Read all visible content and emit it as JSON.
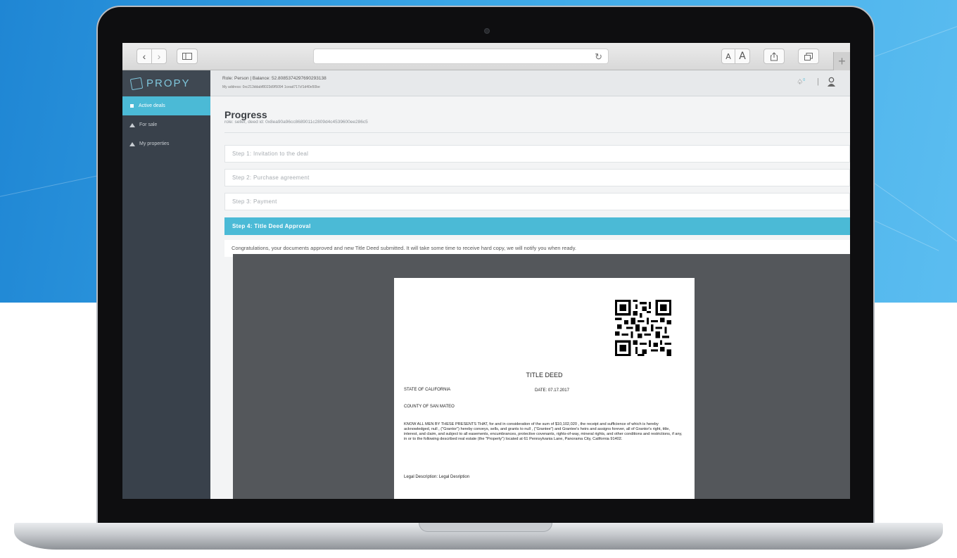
{
  "toolbar": {
    "back_icon": "chevron-left",
    "forward_icon": "chevron-right",
    "sidebar_icon": "sidebar",
    "reload_icon": "reload",
    "font_small": "A",
    "font_large": "A",
    "share_icon": "share",
    "tabs_icon": "tabs",
    "newtab": "+"
  },
  "brand": {
    "name": "PROPY"
  },
  "sidebar": {
    "items": [
      {
        "label": "Active deals",
        "icon": "grid-icon",
        "active": true
      },
      {
        "label": "For sale",
        "icon": "home-icon",
        "active": false
      },
      {
        "label": "My properties",
        "icon": "home-icon",
        "active": false
      }
    ]
  },
  "topbar": {
    "role_balance": "Role: Person | Balance: 52.8085374297690293138",
    "address": "My address: 0xc213ddabf8023d9f5094 1cead717cf1d40e50be",
    "notification_count": "0"
  },
  "page": {
    "title": "Progress",
    "subtitle": "role: seller, deed id: 0x8ea90a96cc8689011c2809d4c4539600ee286c5"
  },
  "steps": [
    {
      "label": "Step 1: Invitation to the deal",
      "active": false
    },
    {
      "label": "Step 2: Purchase agreement",
      "active": false
    },
    {
      "label": "Step 3: Payment",
      "active": false
    },
    {
      "label": "Step 4: Title Deed Approval",
      "active": true
    }
  ],
  "message": "Congratulations, your documents approved and new Title Deed submitted. It will take some time to receive hard copy, we will notify you when ready.",
  "deed": {
    "title": "TITLE DEED",
    "state": "STATE OF CALIFORNIA",
    "date": "DATE: 07.17.2017",
    "county": "COUNTY OF SAN MATEO",
    "body": "KNOW ALL MEN BY THESE PRESENTS THAT, for and in consideration of the sum of $10,102,020 , the receipt and sufficience of which is hereby acknowledged, null , (\"Grantor\") hereby conveys, sells, and grants to null , (\"Grantee\") and Grantee's heirs and assigns forever, all of Grantor's right, title, interest, and claim, and subject to all easements, encumbrances, protective covenants, rights-of-way, mineral rights, and other conditions and restrictions, if any, in or to the following described real estate (the \"Property\") located at 61 Pennsylvania Lane, Panorama City,  California 91402.",
    "legal": "Legal Description: Legal Desription"
  },
  "colors": {
    "accent": "#4bbad6",
    "sidebar": "#39414b",
    "backdrop": "#2f9be0"
  }
}
